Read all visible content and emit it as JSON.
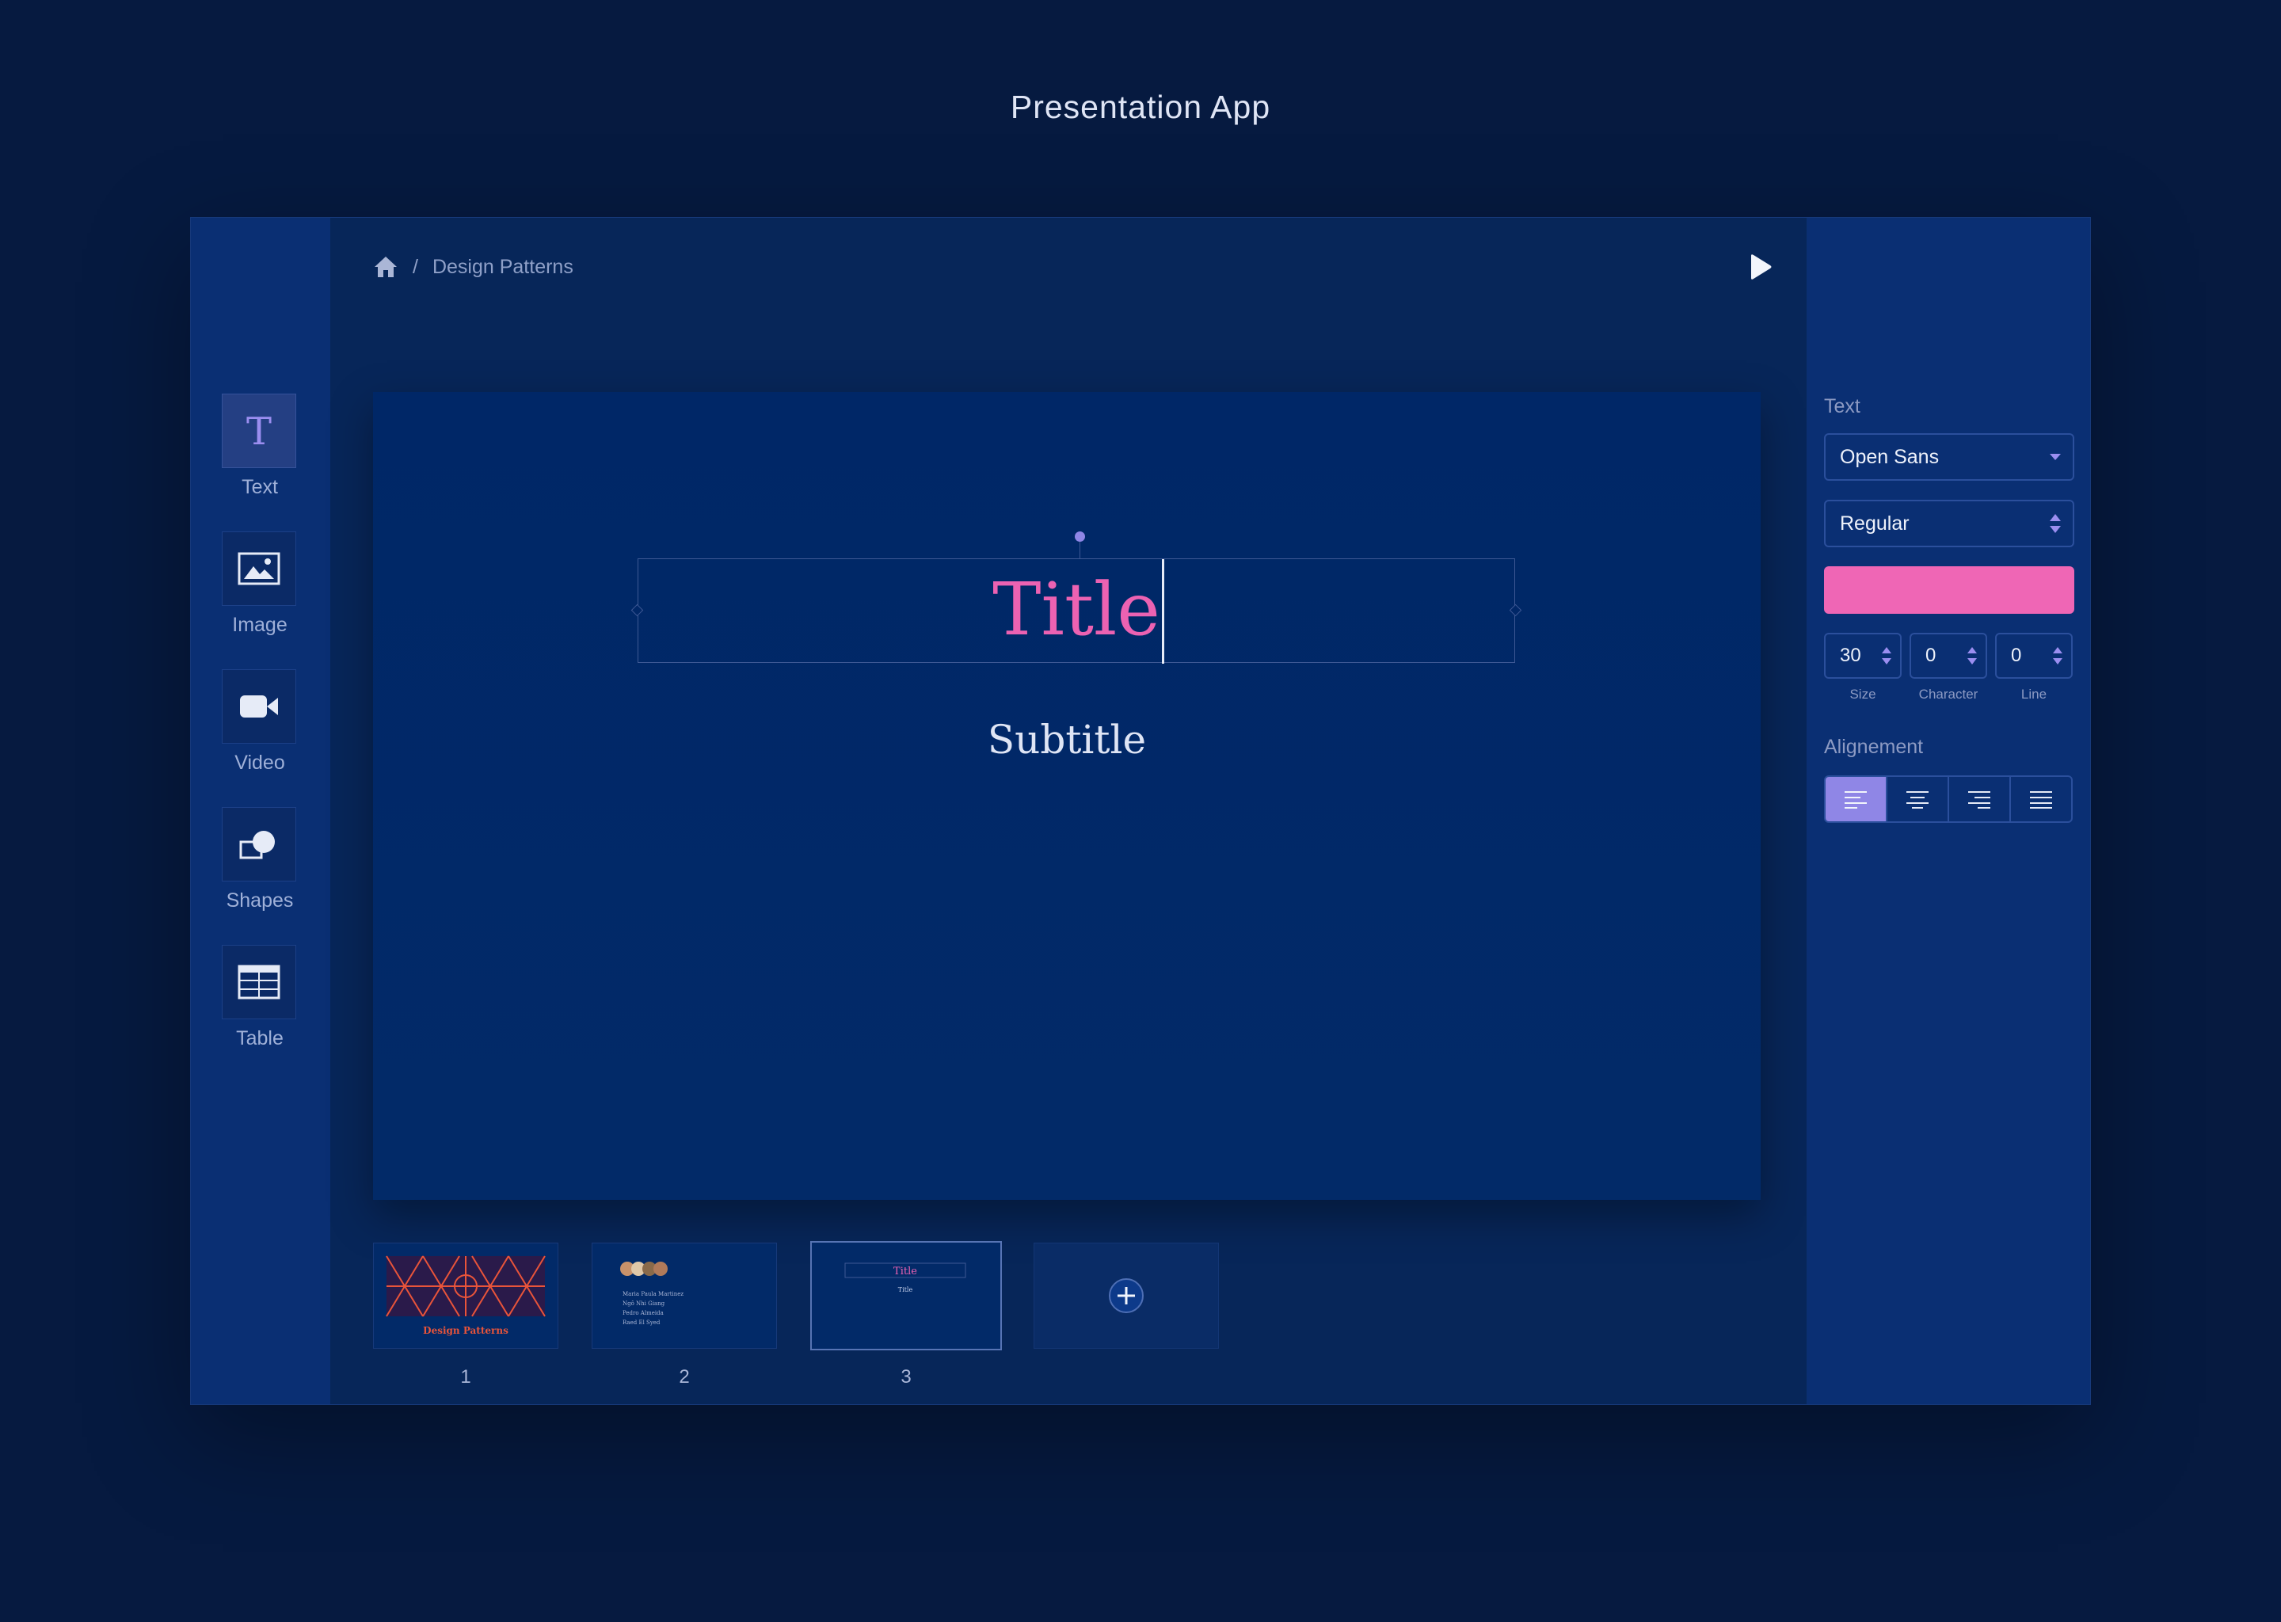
{
  "app_title": "Presentation App",
  "breadcrumb": {
    "current": "Design Patterns"
  },
  "tools": [
    {
      "label": "Text",
      "icon": "text-icon"
    },
    {
      "label": "Image",
      "icon": "image-icon"
    },
    {
      "label": "Video",
      "icon": "video-camera-icon"
    },
    {
      "label": "Shapes",
      "icon": "shapes-icon"
    },
    {
      "label": "Table",
      "icon": "table-icon"
    }
  ],
  "slide": {
    "title": "Title",
    "subtitle": "Subtitle"
  },
  "thumbnails": [
    {
      "number": "1",
      "caption": "Design Patterns"
    },
    {
      "number": "2",
      "lines": [
        "Maria Paula Martinez",
        "Ngô Nhi Giang",
        "Pedro Almeida",
        "Raed El Syed"
      ]
    },
    {
      "number": "3",
      "title": "Title",
      "subtitle": "Title"
    }
  ],
  "panel": {
    "section_text": "Text",
    "font_family": "Open Sans",
    "font_weight": "Regular",
    "text_color": "#ef66b5",
    "size": {
      "value": "30",
      "label": "Size"
    },
    "character": {
      "value": "0",
      "label": "Character"
    },
    "line": {
      "value": "0",
      "label": "Line"
    },
    "section_alignment": "Alignement"
  },
  "colors": {
    "accent": "#8f86e6",
    "title_pink": "#ec62b2",
    "background": "#061a40"
  }
}
